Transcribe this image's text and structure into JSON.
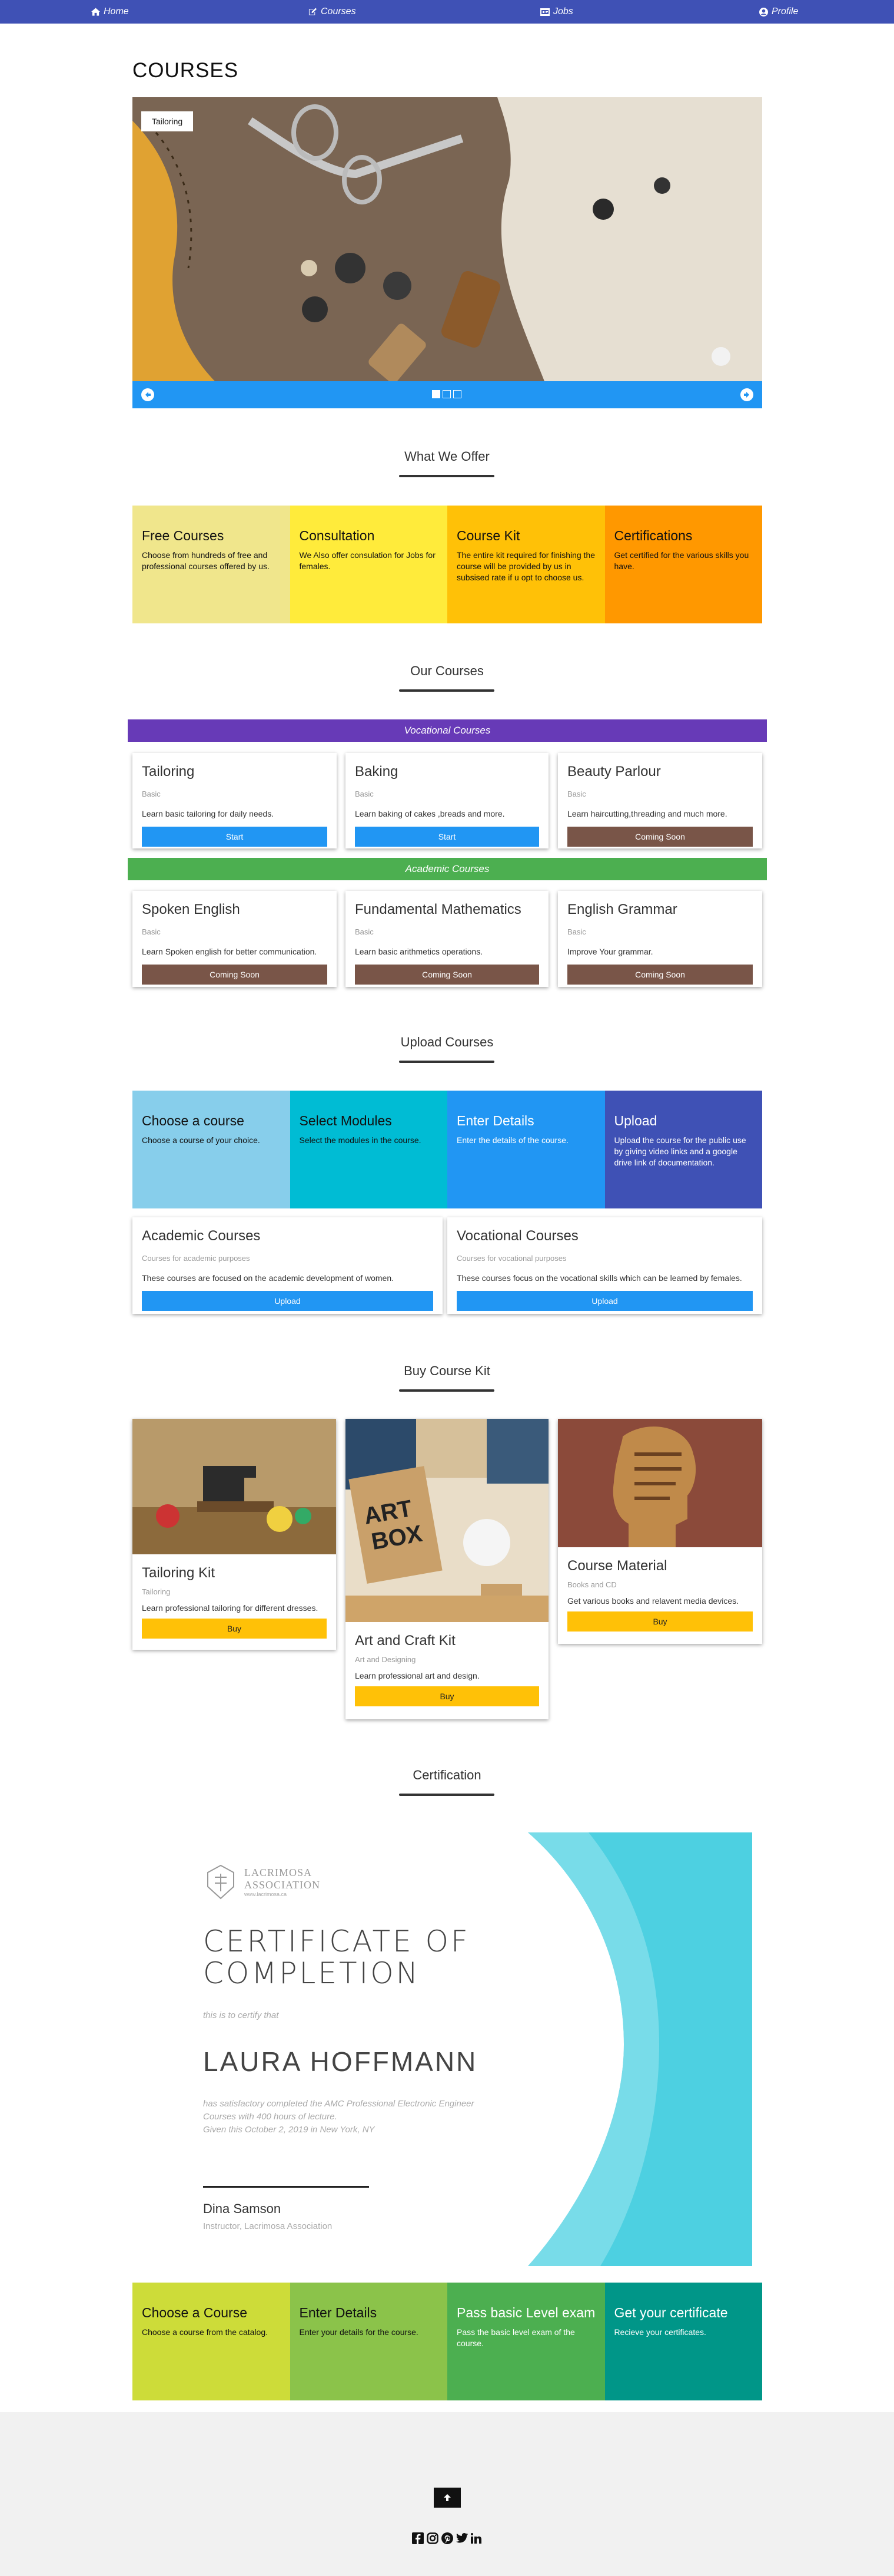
{
  "nav": {
    "home": "Home",
    "courses": "Courses",
    "jobs": "Jobs",
    "profile": "Profile"
  },
  "page_title": "COURSES",
  "carousel": {
    "caption": "Tailoring",
    "slides": 3,
    "active": 1
  },
  "offer": {
    "title": "What We Offer",
    "tiles": [
      {
        "title": "Free Courses",
        "text": "Choose from hundreds of free and professional courses offered by us.",
        "color": "#f0e68c"
      },
      {
        "title": "Consultation",
        "text": "We Also offer consulation for Jobs for females.",
        "color": "#ffeb3b"
      },
      {
        "title": "Course Kit",
        "text": "The entire kit required for finishing the course will be provided by us in subsised rate if u opt to choose us.",
        "color": "#ffc107"
      },
      {
        "title": "Certifications",
        "text": "Get certified for the various skills you have.",
        "color": "#ff9800"
      }
    ]
  },
  "our_courses": {
    "title": "Our Courses",
    "vocational_label": "Vocational Courses",
    "academic_label": "Academic Courses",
    "vocational": [
      {
        "name": "Tailoring",
        "level": "Basic",
        "desc": "Learn basic tailoring for daily needs.",
        "btn": "Start",
        "state": "start"
      },
      {
        "name": "Baking",
        "level": "Basic",
        "desc": "Learn baking of cakes ,breads and more.",
        "btn": "Start",
        "state": "start"
      },
      {
        "name": "Beauty Parlour",
        "level": "Basic",
        "desc": "Learn haircutting,threading and much more.",
        "btn": "Coming Soon",
        "state": "soon"
      }
    ],
    "academic": [
      {
        "name": "Spoken English",
        "level": "Basic",
        "desc": "Learn Spoken english for better communication.",
        "btn": "Coming Soon",
        "state": "soon"
      },
      {
        "name": "Fundamental Mathematics",
        "level": "Basic",
        "desc": "Learn basic arithmetics operations.",
        "btn": "Coming Soon",
        "state": "soon"
      },
      {
        "name": "English Grammar",
        "level": "Basic",
        "desc": "Improve Your grammar.",
        "btn": "Coming Soon",
        "state": "soon"
      }
    ]
  },
  "upload": {
    "title": "Upload Courses",
    "tiles": [
      {
        "title": "Choose a course",
        "text": "Choose a course of your choice.",
        "color": "#87ceeb",
        "dark": true
      },
      {
        "title": "Select Modules",
        "text": "Select the modules in the course.",
        "color": "#00bcd4",
        "dark": true
      },
      {
        "title": "Enter Details",
        "text": "Enter the details of the course.",
        "color": "#2196f3",
        "dark": false
      },
      {
        "title": "Upload",
        "text": "Upload the course for the public use by giving video links and a google drive link of documentation.",
        "color": "#3f51b5",
        "dark": false
      }
    ],
    "cards": [
      {
        "name": "Academic Courses",
        "sub": "Courses for academic purposes",
        "desc": "These courses are focused on the academic development of women.",
        "btn": "Upload"
      },
      {
        "name": "Vocational Courses",
        "sub": "Courses for vocational purposes",
        "desc": "These courses focus on the vocational skills which can be learned by females.",
        "btn": "Upload"
      }
    ]
  },
  "kit": {
    "title": "Buy Course Kit",
    "items": [
      {
        "name": "Tailoring Kit",
        "sub": "Tailoring",
        "desc": "Learn professional tailoring for different dresses.",
        "btn": "Buy"
      },
      {
        "name": "Art and Craft Kit",
        "sub": "Art and Designing",
        "desc": "Learn professional art and design.",
        "btn": "Buy"
      },
      {
        "name": "Course Material",
        "sub": "Books and CD",
        "desc": "Get various books and relavent media devices.",
        "btn": "Buy"
      }
    ]
  },
  "certification": {
    "title": "Certification",
    "org_line1": "LACRIMOSA",
    "org_line2": "ASSOCIATION",
    "org_url": "www.lacrimosa.ca",
    "heading_line1": "CERTIFICATE OF",
    "heading_line2": "COMPLETION",
    "certify": "this is to certify that",
    "recipient": "LAURA HOFFMANN",
    "body_line1": "has satisfactory completed the AMC Professional Electronic Engineer",
    "body_line2": "Courses with 400 hours of lecture.",
    "body_line3": "Given this October 2, 2019 in New York, NY",
    "signer": "Dina Samson",
    "signer_title": "Instructor, Lacrimosa Association"
  },
  "steps": [
    {
      "title": "Choose a Course",
      "text": "Choose a course from the catalog.",
      "color": "#cddc39",
      "dark": true
    },
    {
      "title": "Enter Details",
      "text": "Enter your details for the course.",
      "color": "#8bc34a",
      "dark": true
    },
    {
      "title": "Pass basic Level exam",
      "text": "Pass the basic level exam of the course.",
      "color": "#4caf50",
      "dark": false
    },
    {
      "title": "Get your certificate",
      "text": "Recieve your certificates.",
      "color": "#009688",
      "dark": false
    }
  ],
  "colors": {
    "nav": "#3f51b5",
    "vocational_band": "#673ab7",
    "academic_band": "#4caf50",
    "start": "#2196f3",
    "soon": "#795548",
    "buy": "#ffc107"
  },
  "footer": {
    "icons": [
      "facebook-icon",
      "instagram-icon",
      "pinterest-icon",
      "twitter-icon",
      "linkedin-icon"
    ]
  }
}
